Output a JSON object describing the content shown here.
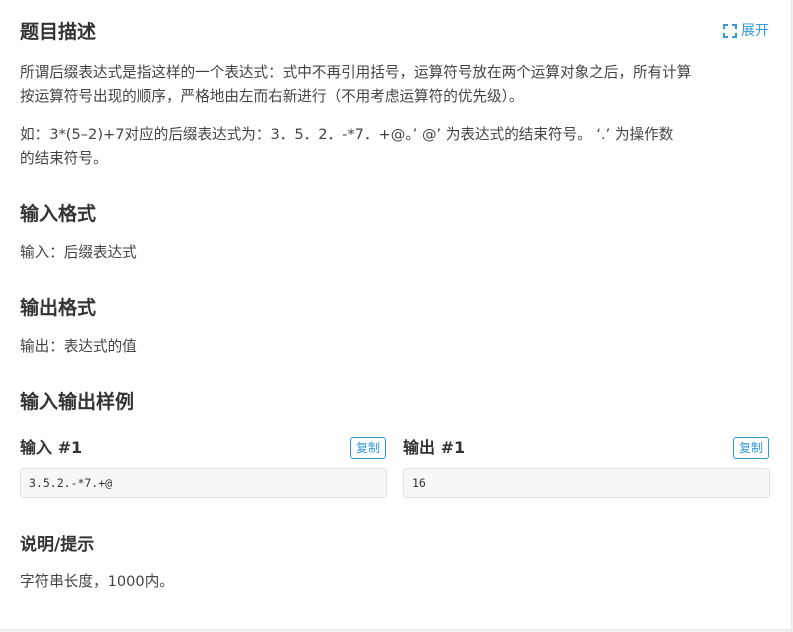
{
  "problem": {
    "description_title": "题目描述",
    "expand_label": "展开",
    "description_lines": [
      "所谓后缀表达式是指这样的一个表达式：式中不再引用括号，运算符号放在两个运算对象之后，所有计算",
      "按运算符号出现的顺序，严格地由左而右新进行（不用考虑运算符的优先级）。"
    ],
    "example_lines": [
      "如：3*(5–2)+7对应的后缀表达式为：3．5．2．-*7．+@。’ @’ 为表达式的结束符号。 ‘.’ 为操作数",
      "的结束符号。"
    ],
    "input_format_title": "输入格式",
    "input_format_text": "输入：后缀表达式",
    "output_format_title": "输出格式",
    "output_format_text": "输出：表达式的值",
    "samples_title": "输入输出样例",
    "sample_input_label": "输入 #1",
    "sample_output_label": "输出 #1",
    "copy_label": "复制",
    "sample_input_value": "3.5.2.-*7.+@",
    "sample_output_value": "16",
    "hint_title": "说明/提示",
    "hint_text": "字符串长度，1000内。"
  },
  "colors": {
    "accent": "#3498db",
    "text": "#333333",
    "code_bg": "#f7f7f7"
  },
  "icons": {
    "expand": "expand-icon"
  }
}
